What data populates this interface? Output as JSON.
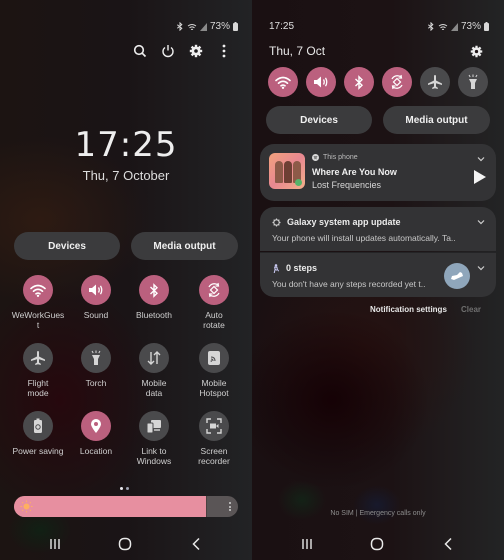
{
  "status_bar": {
    "icons": [
      "bluetooth-icon",
      "wifi-icon",
      "signal-icon",
      "battery-icon"
    ],
    "battery": "73%"
  },
  "left_panel": {
    "toolbar": [
      "search-icon",
      "power-icon",
      "settings-icon",
      "more-options-icon"
    ],
    "time": "17:25",
    "date": "Thu, 7 October",
    "devices_label": "Devices",
    "media_output_label": "Media output",
    "tiles": [
      {
        "label": "WeWorkGues\nt",
        "icon": "wifi-icon",
        "on": true
      },
      {
        "label": "Sound",
        "icon": "sound-icon",
        "on": true
      },
      {
        "label": "Bluetooth",
        "icon": "bluetooth-icon",
        "on": true
      },
      {
        "label": "Auto\nrotate",
        "icon": "auto-rotate-icon",
        "on": true
      },
      {
        "label": "Flight\nmode",
        "icon": "airplane-icon",
        "on": false
      },
      {
        "label": "Torch",
        "icon": "torch-icon",
        "on": false
      },
      {
        "label": "Mobile\ndata",
        "icon": "mobile-data-icon",
        "on": false
      },
      {
        "label": "Mobile\nHotspot",
        "icon": "hotspot-icon",
        "on": false
      },
      {
        "label": "Power saving",
        "icon": "power-saving-icon",
        "on": false
      },
      {
        "label": "Location",
        "icon": "location-icon",
        "on": true
      },
      {
        "label": "Link to\nWindows",
        "icon": "link-to-windows-icon",
        "on": false
      },
      {
        "label": "Screen\nrecorder",
        "icon": "screen-recorder-icon",
        "on": false
      }
    ],
    "page_count": 2,
    "active_page": 1,
    "brightness_percent": 86
  },
  "right_panel": {
    "time": "17:25",
    "date": "Thu, 7 Oct",
    "quick_icons": [
      {
        "icon": "wifi-icon",
        "on": true
      },
      {
        "icon": "sound-icon",
        "on": true
      },
      {
        "icon": "bluetooth-icon",
        "on": true
      },
      {
        "icon": "auto-rotate-icon",
        "on": true
      },
      {
        "icon": "airplane-icon",
        "on": false
      },
      {
        "icon": "torch-icon",
        "on": false
      }
    ],
    "devices_label": "Devices",
    "media_output_label": "Media output",
    "media": {
      "source": "This phone",
      "title": "Where Are You Now",
      "artist": "Lost Frequencies"
    },
    "notifications": [
      {
        "title": "Galaxy system app update",
        "body": "Your phone will install updates automatically. Ta..",
        "icon": "gear-icon"
      },
      {
        "title": "0 steps",
        "body": "You don't have any steps recorded yet t..",
        "icon": "walking-icon"
      }
    ],
    "notification_settings_label": "Notification settings",
    "clear_label": "Clear",
    "carrier_text": "No SIM | Emergency calls only"
  },
  "navigation": [
    "recent-apps-icon",
    "home-icon",
    "back-icon"
  ],
  "colors": {
    "active": "#bb607e",
    "inactive": "#4a4a4c",
    "brightness": "#e78fa0"
  }
}
